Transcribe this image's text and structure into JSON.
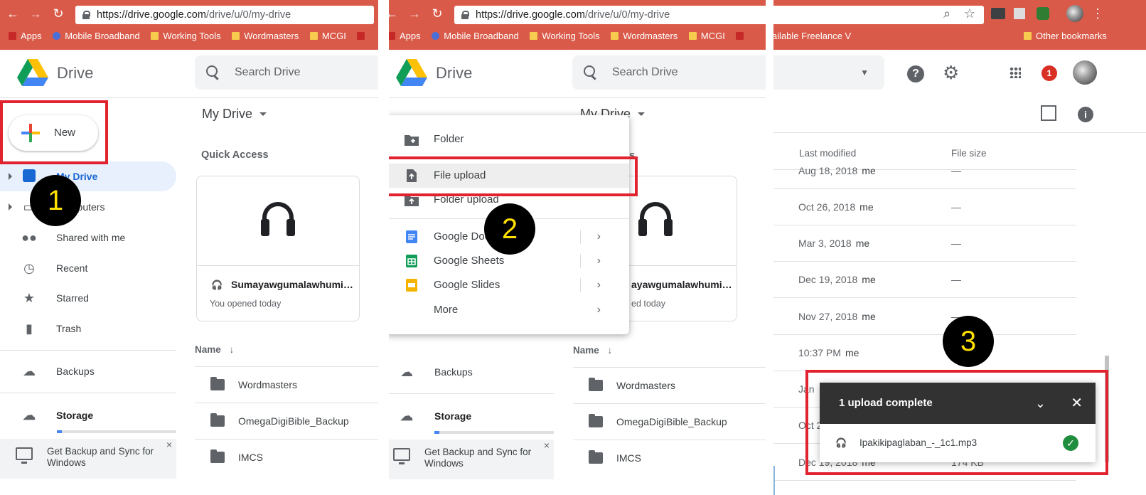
{
  "browser": {
    "url_host": "https://drive.google.com",
    "url_path": "/drive/u/0/my-drive",
    "bookmarks": [
      "Apps",
      "Mobile Broadband",
      "Working Tools",
      "Wordmasters",
      "MCGI",
      "Available Freelance V",
      "Other bookmarks"
    ]
  },
  "app": {
    "name": "Drive",
    "search_placeholder": "Search Drive"
  },
  "sidebar": {
    "new_label": "New",
    "items": [
      "My Drive",
      "Computers",
      "Shared with me",
      "Recent",
      "Starred",
      "Trash",
      "Backups",
      "Storage"
    ],
    "promo_text": "Get Backup and Sync for Windows",
    "promo_close": "×"
  },
  "main": {
    "title": "My Drive",
    "quick_access_label": "Quick Access",
    "quick_file_name": "Sumayawgumalawhumi…",
    "quick_file_name_short": "ayawgumalawhumi…",
    "quick_file_sub": "You opened today",
    "quick_file_sub_short": "ed today",
    "name_header": "Name",
    "sort_arrow": "↓",
    "folders": [
      "Wordmasters",
      "OmegaDigiBible_Backup",
      "IMCS"
    ]
  },
  "new_menu": {
    "items": [
      {
        "label": "Folder",
        "submenu": false
      },
      {
        "label": "File upload",
        "submenu": false
      },
      {
        "label": "Folder upload",
        "submenu": false
      },
      {
        "label": "Google Docs",
        "submenu": true
      },
      {
        "label": "Google Sheets",
        "submenu": true
      },
      {
        "label": "Google Slides",
        "submenu": true
      },
      {
        "label": "More",
        "submenu": true
      }
    ],
    "title_overlap": "My Drive",
    "qa_overlap": "ss"
  },
  "list": {
    "headers": {
      "modified": "Last modified",
      "size": "File size"
    },
    "rows": [
      {
        "modified": "Aug 18, 2018",
        "by": "me",
        "size": "—"
      },
      {
        "modified": "Oct 26, 2018",
        "by": "me",
        "size": "—"
      },
      {
        "modified": "Mar 3, 2018",
        "by": "me",
        "size": "—"
      },
      {
        "modified": "Dec 19, 2018",
        "by": "me",
        "size": "—"
      },
      {
        "modified": "Nov 27, 2018",
        "by": "me",
        "size": "—"
      },
      {
        "modified": "10:37 PM",
        "by": "me",
        "size": ""
      },
      {
        "modified": "Jan",
        "by": "",
        "size": ""
      },
      {
        "modified": "Oct 2",
        "by": "",
        "size": ""
      },
      {
        "modified": "Dec 19, 2018",
        "by": "me",
        "size": "174 KB"
      }
    ],
    "notification_count": "1"
  },
  "upload_toast": {
    "title": "1 upload complete",
    "file": "Ipakikipaglaban_-_1c1.mp3"
  },
  "markers": [
    "1",
    "2",
    "3"
  ],
  "colors": {
    "highlight_box": "#e0232e",
    "marker_text": "#ffe000",
    "chrome_bar": "#da5a4a",
    "drive_blue": "#1967d2"
  }
}
